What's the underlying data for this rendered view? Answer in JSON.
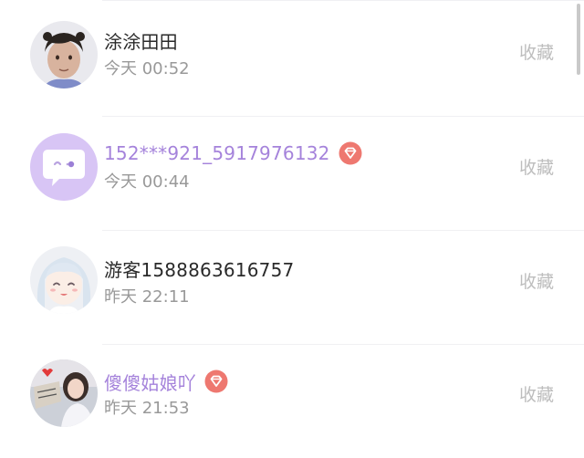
{
  "items": [
    {
      "name": "涂涂田田",
      "time": "今天 00:52",
      "action": "收藏",
      "vip": false,
      "avatar": "boy-photo-avatar"
    },
    {
      "name": "152***921_5917976132",
      "time": "今天 00:44",
      "action": "收藏",
      "vip": true,
      "avatar": "chat-bubble-avatar"
    },
    {
      "name": "游客1588863616757",
      "time": "昨天 22:11",
      "action": "收藏",
      "vip": false,
      "avatar": "anime-girl-avatar"
    },
    {
      "name": "傻傻姑娘吖",
      "time": "昨天 21:53",
      "action": "收藏",
      "vip": true,
      "avatar": "girl-photo-avatar"
    }
  ],
  "colors": {
    "vip_name": "#a583db",
    "vip_badge": "#ee7870",
    "time": "#999999",
    "action": "#bdbdbd",
    "avatar_bubble_bg": "#d8c5f5"
  },
  "icons": {
    "vip_badge": "diamond-badge-icon",
    "scrollbar": "scrollbar-thumb"
  }
}
